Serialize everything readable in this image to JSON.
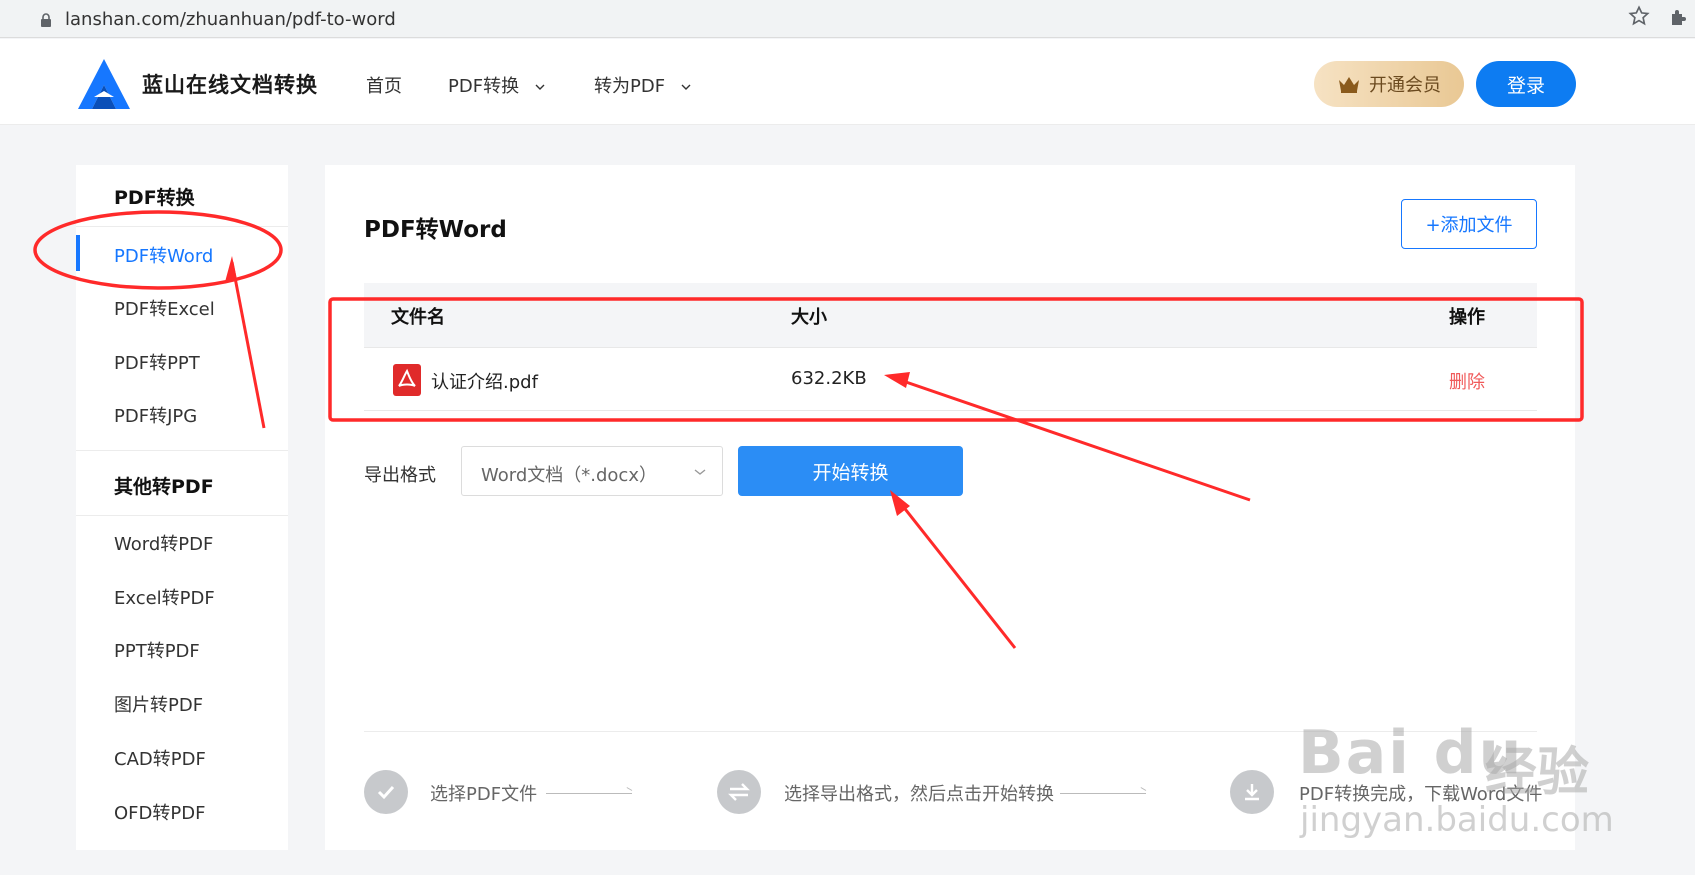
{
  "browser": {
    "url": "lanshan.com/zhuanhuan/pdf-to-word"
  },
  "header": {
    "brand": "蓝山在线文档转换",
    "nav": [
      {
        "label": "首页"
      },
      {
        "label": "PDF转换"
      },
      {
        "label": "转为PDF"
      }
    ],
    "vip_label": "开通会员",
    "login_label": "登录"
  },
  "sidebar": {
    "groups": [
      {
        "title": "PDF转换",
        "items": [
          {
            "label": "PDF转Word",
            "active": true
          },
          {
            "label": "PDF转Excel"
          },
          {
            "label": "PDF转PPT"
          },
          {
            "label": "PDF转JPG"
          }
        ]
      },
      {
        "title": "其他转PDF",
        "items": [
          {
            "label": "Word转PDF"
          },
          {
            "label": "Excel转PDF"
          },
          {
            "label": "PPT转PDF"
          },
          {
            "label": "图片转PDF"
          },
          {
            "label": "CAD转PDF"
          },
          {
            "label": "OFD转PDF"
          }
        ]
      }
    ]
  },
  "main": {
    "title": "PDF转Word",
    "add_file_label": "+添加文件",
    "table": {
      "headers": [
        "文件名",
        "大小",
        "操作"
      ],
      "rows": [
        {
          "filename": "认证介绍.pdf",
          "size": "632.2KB",
          "action": "删除"
        }
      ]
    },
    "export_label": "导出格式",
    "format_value": "Word文档（*.docx）",
    "start_label": "开始转换",
    "steps": [
      {
        "text": "选择PDF文件",
        "icon": "check-icon"
      },
      {
        "text": "选择导出格式，然后点击开始转换",
        "icon": "swap-icon"
      },
      {
        "text": "PDF转换完成，下载Word文件",
        "icon": "download-icon"
      }
    ]
  },
  "watermark": {
    "main": "Bai du",
    "cn": "经验",
    "sub": "jingyan.baidu.com"
  },
  "colors": {
    "accent": "#1677ff",
    "annotation": "#ff2a2a",
    "delete": "#f05a5a"
  }
}
